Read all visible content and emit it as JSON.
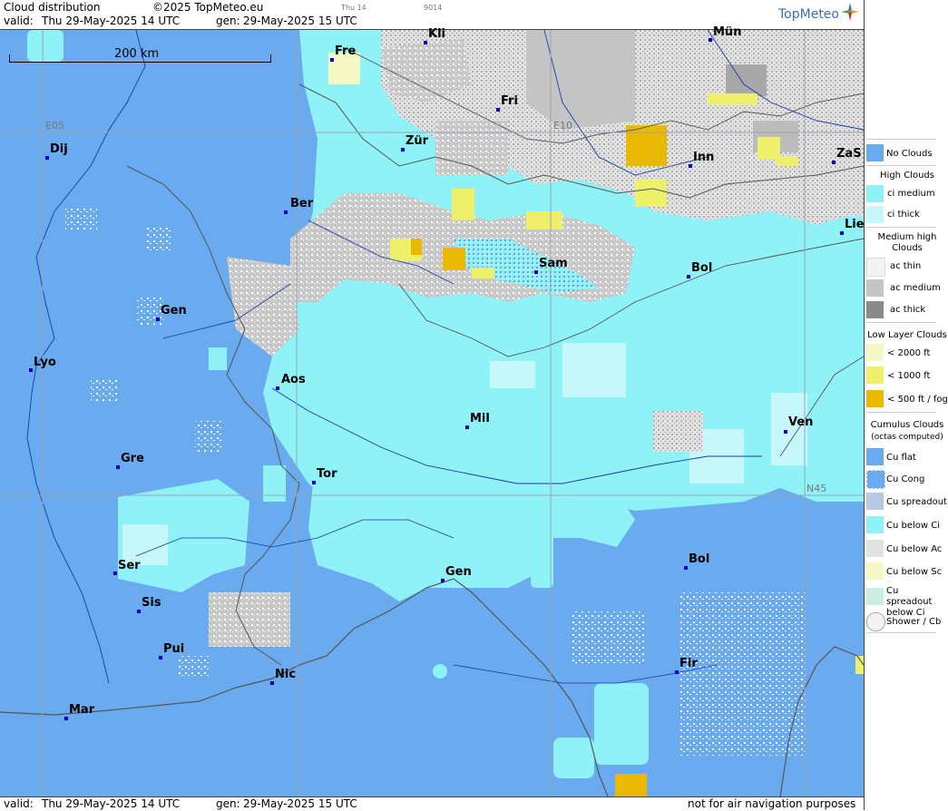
{
  "header": {
    "title": "Cloud distribution",
    "copyright": "©2025 TopMeteo.eu",
    "tab_small": "Thu 14",
    "code_small": "9014",
    "valid_label": "valid:",
    "valid_value": "Thu  29-May-2025  14 UTC",
    "gen_label": "gen:",
    "gen_value": "29-May-2025 15 UTC",
    "logo_text": "TopMeteo"
  },
  "footer": {
    "valid_label": "valid:",
    "valid_value": "Thu  29-May-2025  14 UTC",
    "gen_label": "gen:",
    "gen_value": "29-May-2025 15 UTC",
    "disclaimer": "not for air navigation purposes"
  },
  "map": {
    "scale_label": "200 km",
    "grid_labels": {
      "lon1": "E05",
      "lon2": "E10",
      "lat": "N45"
    },
    "cities": [
      "Kli",
      "Mün",
      "Fre",
      "Fri",
      "Zür",
      "Inn",
      "ZaS",
      "Ber",
      "Lie",
      "Sam",
      "Bol",
      "Dij",
      "Gen",
      "Lyo",
      "Aos",
      "Mil",
      "Ven",
      "Gre",
      "Tor",
      "Ser",
      "Gen",
      "Bol",
      "Sis",
      "Pui",
      "Nic",
      "Fir",
      "Mar"
    ]
  },
  "legend": {
    "no_clouds": "No Clouds",
    "high_title": "High Clouds",
    "ci_medium": "ci medium",
    "ci_thick": "ci thick",
    "medium_title": "Medium high Clouds",
    "ac_thin": "ac thin",
    "ac_medium": "ac medium",
    "ac_thick": "ac thick",
    "low_title": "Low Layer Clouds",
    "low_2000": "< 2000 ft",
    "low_1000": "< 1000 ft",
    "low_500": "< 500 ft / fog",
    "cu_title": "Cumulus Clouds",
    "cu_subtitle": "(octas computed)",
    "cu_flat": "Cu flat",
    "cu_cong": "Cu Cong",
    "cu_spreadout": "Cu spreadout",
    "cu_below_ci": "Cu below Ci",
    "cu_below_ac": "Cu below Ac",
    "cu_below_sc": "Cu below Sc",
    "cu_spreadout_below_ci": "Cu spreadout below Ci",
    "shower_cb": "Shower / Cb"
  },
  "colors": {
    "no_clouds": "#6aaaef",
    "ci_medium": "#8ff2f7",
    "ci_thick": "#c6f7fb",
    "ac_thin": "#f3f3f3",
    "ac_medium": "#c4c4c4",
    "ac_thick": "#8a8a8a",
    "low_2000": "#f5f7c4",
    "low_1000": "#eef06a",
    "low_500": "#e9b800"
  }
}
